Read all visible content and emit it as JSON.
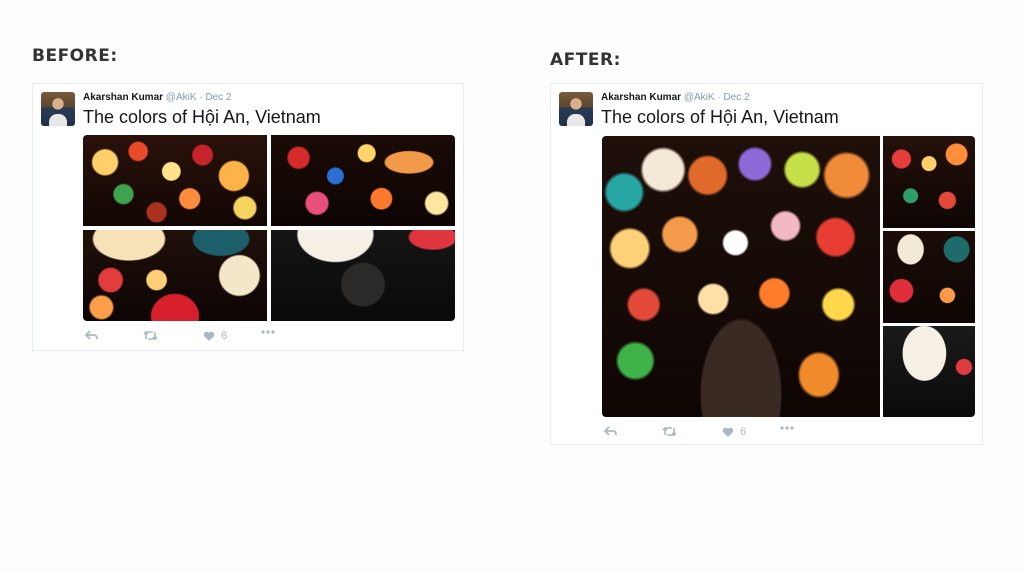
{
  "labels": {
    "before": "BEFORE:",
    "after": "AFTER:"
  },
  "tweet": {
    "name": "Akarshan Kumar",
    "handle": "@AkiK",
    "sep": "·",
    "date": "Dec 2",
    "text": "The colors of Hội An, Vietnam",
    "likes": "6"
  },
  "icons": [
    "reply-icon",
    "retweet-icon",
    "heart-icon",
    "more-icon"
  ]
}
